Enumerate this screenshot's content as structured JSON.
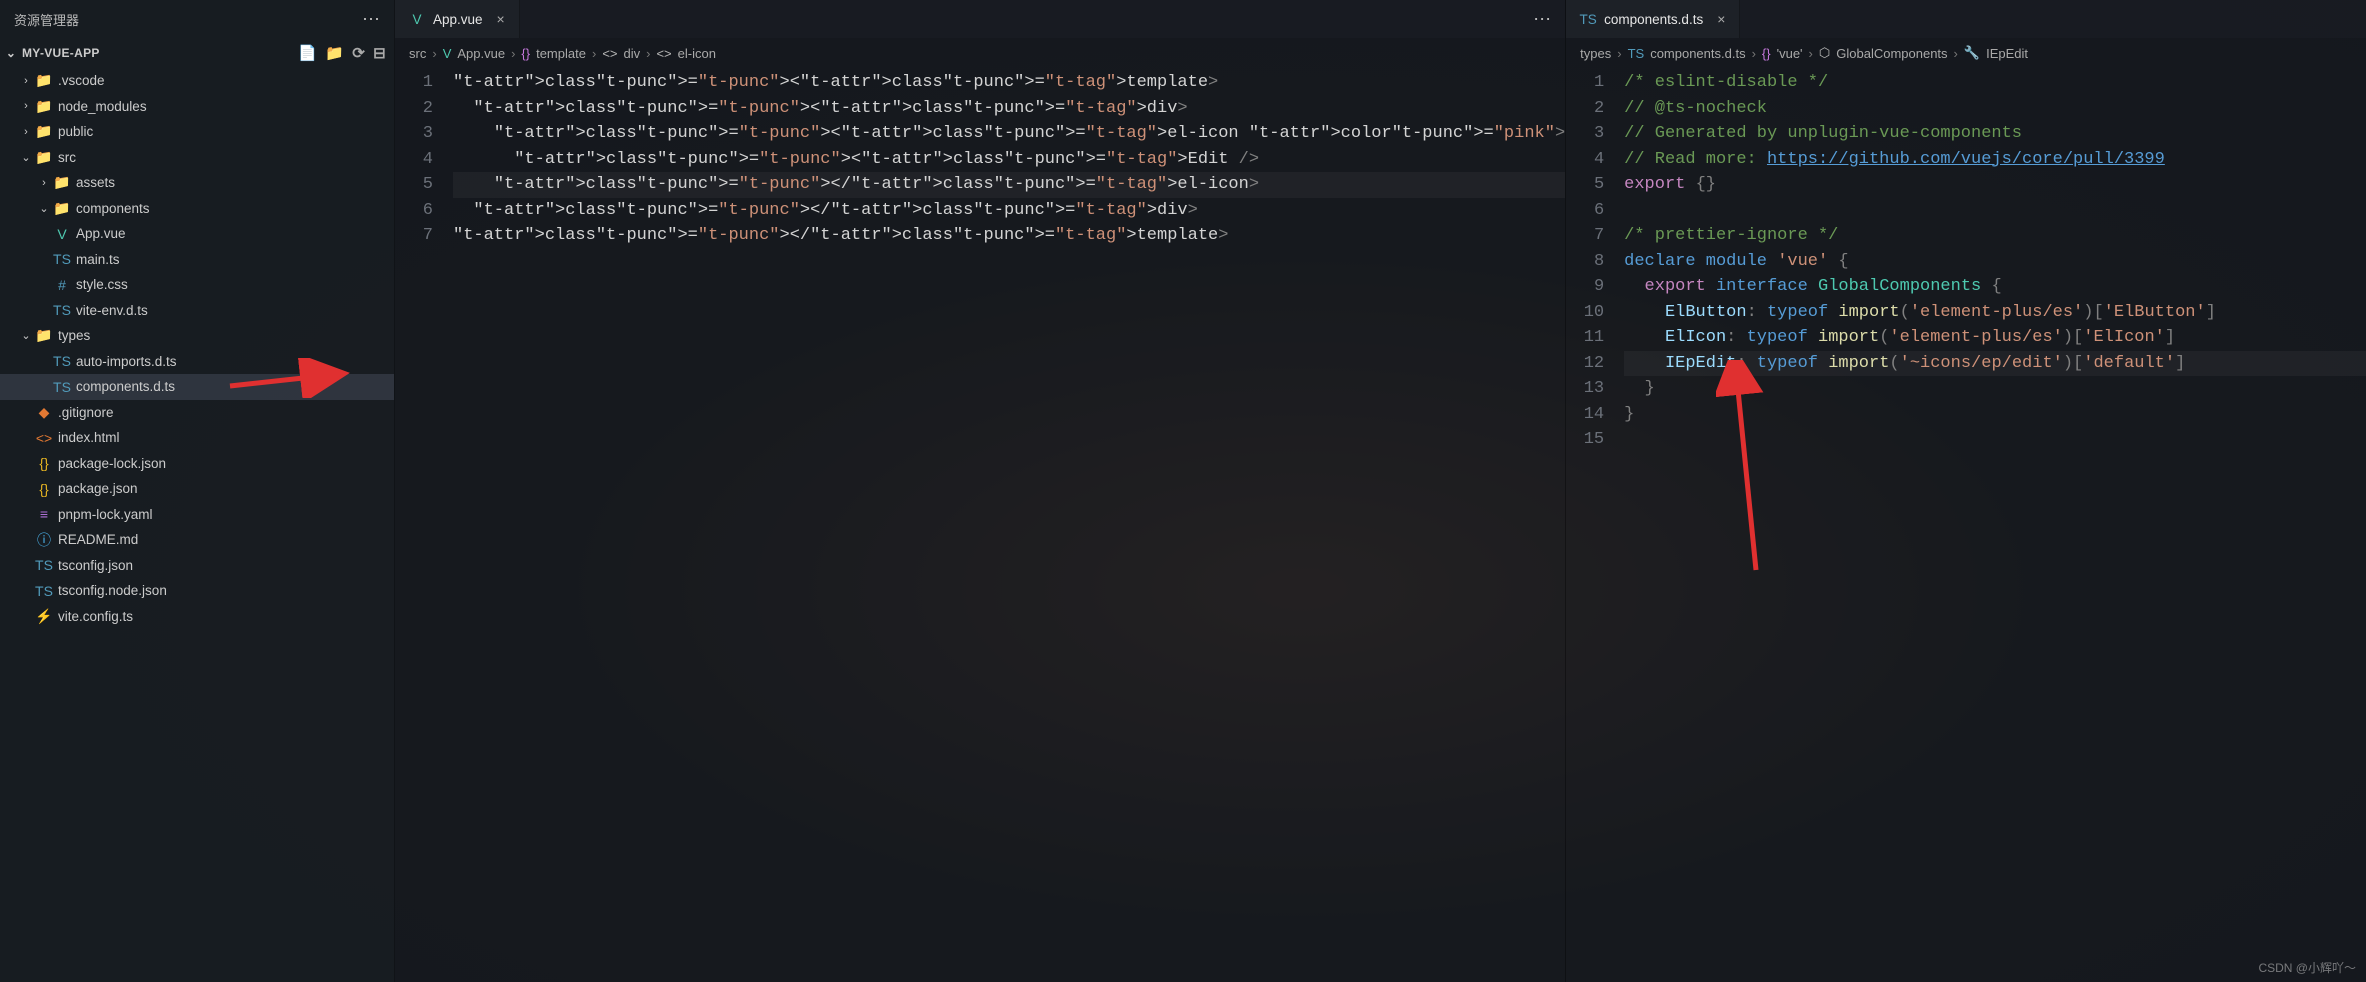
{
  "sidebar": {
    "title": "资源管理器",
    "project_name": "MY-VUE-APP",
    "actions": {
      "new_file": "new-file-icon",
      "new_folder": "new-folder-icon",
      "refresh": "refresh-icon",
      "collapse": "collapse-icon"
    },
    "tree": [
      {
        "depth": 0,
        "kind": "folder",
        "expanded": false,
        "icon": "folder-blue",
        "label": ".vscode"
      },
      {
        "depth": 0,
        "kind": "folder",
        "expanded": false,
        "icon": "folder-green",
        "label": "node_modules"
      },
      {
        "depth": 0,
        "kind": "folder",
        "expanded": false,
        "icon": "folder-blue",
        "label": "public"
      },
      {
        "depth": 0,
        "kind": "folder",
        "expanded": true,
        "icon": "folder-green2",
        "label": "src"
      },
      {
        "depth": 1,
        "kind": "folder",
        "expanded": false,
        "icon": "folder-orange",
        "label": "assets"
      },
      {
        "depth": 1,
        "kind": "folder",
        "expanded": true,
        "icon": "folder-orange",
        "label": "components"
      },
      {
        "depth": 1,
        "kind": "file",
        "icon": "vue",
        "label": "App.vue"
      },
      {
        "depth": 1,
        "kind": "file",
        "icon": "ts",
        "label": "main.ts"
      },
      {
        "depth": 1,
        "kind": "file",
        "icon": "css",
        "label": "style.css"
      },
      {
        "depth": 1,
        "kind": "file",
        "icon": "ts",
        "label": "vite-env.d.ts"
      },
      {
        "depth": 0,
        "kind": "folder",
        "expanded": true,
        "icon": "folder-blue",
        "label": "types"
      },
      {
        "depth": 1,
        "kind": "file",
        "icon": "ts",
        "label": "auto-imports.d.ts"
      },
      {
        "depth": 1,
        "kind": "file",
        "icon": "ts",
        "label": "components.d.ts",
        "selected": true
      },
      {
        "depth": 0,
        "kind": "file",
        "icon": "git",
        "label": ".gitignore"
      },
      {
        "depth": 0,
        "kind": "file",
        "icon": "html",
        "label": "index.html"
      },
      {
        "depth": 0,
        "kind": "file",
        "icon": "json",
        "label": "package-lock.json"
      },
      {
        "depth": 0,
        "kind": "file",
        "icon": "json",
        "label": "package.json"
      },
      {
        "depth": 0,
        "kind": "file",
        "icon": "yaml",
        "label": "pnpm-lock.yaml"
      },
      {
        "depth": 0,
        "kind": "file",
        "icon": "info",
        "label": "README.md"
      },
      {
        "depth": 0,
        "kind": "file",
        "icon": "tsconf",
        "label": "tsconfig.json"
      },
      {
        "depth": 0,
        "kind": "file",
        "icon": "tsconf",
        "label": "tsconfig.node.json"
      },
      {
        "depth": 0,
        "kind": "file",
        "icon": "vite",
        "label": "vite.config.ts"
      }
    ]
  },
  "editor_left": {
    "tab": {
      "icon": "vue",
      "label": "App.vue"
    },
    "breadcrumb": [
      {
        "icon": "",
        "label": "src"
      },
      {
        "icon": "vue",
        "label": "App.vue"
      },
      {
        "icon": "braces",
        "label": "template"
      },
      {
        "icon": "sym",
        "label": "div"
      },
      {
        "icon": "sym",
        "label": "el-icon"
      }
    ],
    "lines": [
      1,
      2,
      3,
      4,
      5,
      6,
      7
    ],
    "code": [
      "<template>",
      "  <div>",
      "    <el-icon color=\"pink\">",
      "      <Edit />",
      "    </el-icon>",
      "  </div>",
      "</template>"
    ]
  },
  "editor_right": {
    "tab": {
      "icon": "ts",
      "label": "components.d.ts"
    },
    "breadcrumb": [
      {
        "icon": "",
        "label": "types"
      },
      {
        "icon": "ts",
        "label": "components.d.ts"
      },
      {
        "icon": "braces",
        "label": "'vue'"
      },
      {
        "icon": "sym",
        "label": "GlobalComponents"
      },
      {
        "icon": "wrench",
        "label": "IEpEdit"
      }
    ],
    "lines": [
      1,
      2,
      3,
      4,
      5,
      6,
      7,
      8,
      9,
      10,
      11,
      12,
      13,
      14,
      15
    ],
    "code_raw": {
      "l1": "/* eslint-disable */",
      "l2": "// @ts-nocheck",
      "l3": "// Generated by unplugin-vue-components",
      "l4a": "// Read more: ",
      "l4b": "https://github.com/vuejs/core/pull/3399",
      "l5a": "export",
      "l5b": "{}",
      "l7": "/* prettier-ignore */",
      "l8a": "declare",
      "l8b": "module",
      "l8c": "'vue'",
      "l8d": "{",
      "l9a": "export",
      "l9b": "interface",
      "l9c": "GlobalComponents",
      "l9d": "{",
      "l10a": "ElButton",
      "l10b": "typeof",
      "l10c": "import",
      "l10d": "'element-plus/es'",
      "l10e": "'ElButton'",
      "l11a": "ElIcon",
      "l11b": "typeof",
      "l11c": "import",
      "l11d": "'element-plus/es'",
      "l11e": "'ElIcon'",
      "l12a": "IEpEdit",
      "l12b": "typeof",
      "l12c": "import",
      "l12d": "'~icons/ep/edit'",
      "l12e": "'default'",
      "l13": "}",
      "l14": "}"
    }
  },
  "watermark": "CSDN @小辉吖～"
}
